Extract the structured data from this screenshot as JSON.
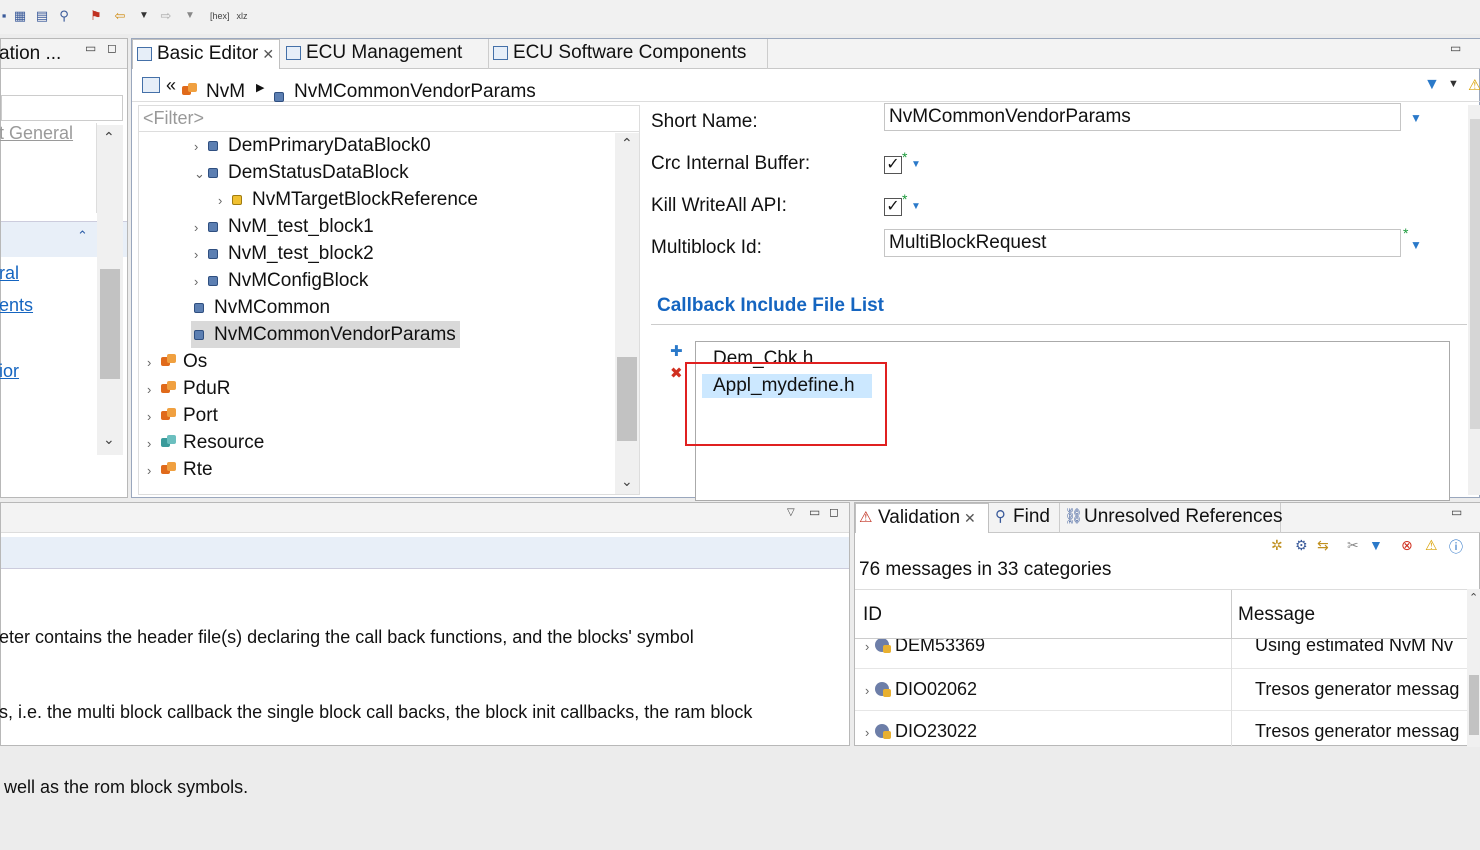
{
  "left_panel": {
    "tab_label": "ation ...",
    "items": [
      "t General",
      "ral",
      "ents",
      "ior"
    ]
  },
  "editor": {
    "tabs": [
      {
        "label": "Basic Editor"
      },
      {
        "label": "ECU Management"
      },
      {
        "label": "ECU Software Components"
      }
    ],
    "breadcrumb": {
      "module": "NvM",
      "item": "NvMCommonVendorParams"
    },
    "filter_placeholder": "<Filter>",
    "tree": [
      {
        "label": "DemPrimaryDataBlock0",
        "twisty": "›"
      },
      {
        "label": "DemStatusDataBlock",
        "twisty": "⌄"
      },
      {
        "label": "NvMTargetBlockReference",
        "twisty": "›"
      },
      {
        "label": "NvM_test_block1",
        "twisty": "›"
      },
      {
        "label": "NvM_test_block2",
        "twisty": "›"
      },
      {
        "label": "NvMConfigBlock",
        "twisty": "›"
      },
      {
        "label": "NvMCommon",
        "twisty": ""
      },
      {
        "label": "NvMCommonVendorParams",
        "twisty": ""
      },
      {
        "label": "Os",
        "twisty": "›"
      },
      {
        "label": "PduR",
        "twisty": "›"
      },
      {
        "label": "Port",
        "twisty": "›"
      },
      {
        "label": "Resource",
        "twisty": "›"
      },
      {
        "label": "Rte",
        "twisty": "›"
      }
    ],
    "form": {
      "short_name_label": "Short Name:",
      "short_name_value": "NvMCommonVendorParams",
      "crc_label": "Crc Internal Buffer:",
      "crc_checked": true,
      "kill_label": "Kill WriteAll API:",
      "kill_checked": true,
      "multiblock_label": "Multiblock Id:",
      "multiblock_value": "MultiBlockRequest",
      "callback_section_title": "Callback Include File List",
      "callback_files": [
        "Dem_Cbk.h",
        "Appl_mydefine.h"
      ],
      "check_mark": "✓",
      "star": "*",
      "add_glyph": "✚",
      "remove_glyph": "✖"
    }
  },
  "description": {
    "lines": [
      "eter contains the header file(s) declaring the call back functions, and the blocks' symbol",
      "s, i.e. the multi block callback the single block call backs, the block init callbacks, the ram block",
      " well as the rom block symbols."
    ]
  },
  "validation": {
    "tabs": [
      {
        "label": "Validation"
      },
      {
        "label": "Find"
      },
      {
        "label": "Unresolved References"
      }
    ],
    "summary": "76 messages in 33 categories",
    "columns": [
      "ID",
      "Message"
    ],
    "rows": [
      {
        "id": "DEM53369",
        "message": "Using estimated NvM Nv"
      },
      {
        "id": "DIO02062",
        "message": "Tresos generator messag"
      },
      {
        "id": "DIO23022",
        "message": "Tresos generator messag"
      }
    ]
  },
  "colors": {
    "accent": "#1565c0",
    "highlight": "#cce8ff",
    "selection": "#d9d9d9",
    "red_box": "#e02020"
  }
}
